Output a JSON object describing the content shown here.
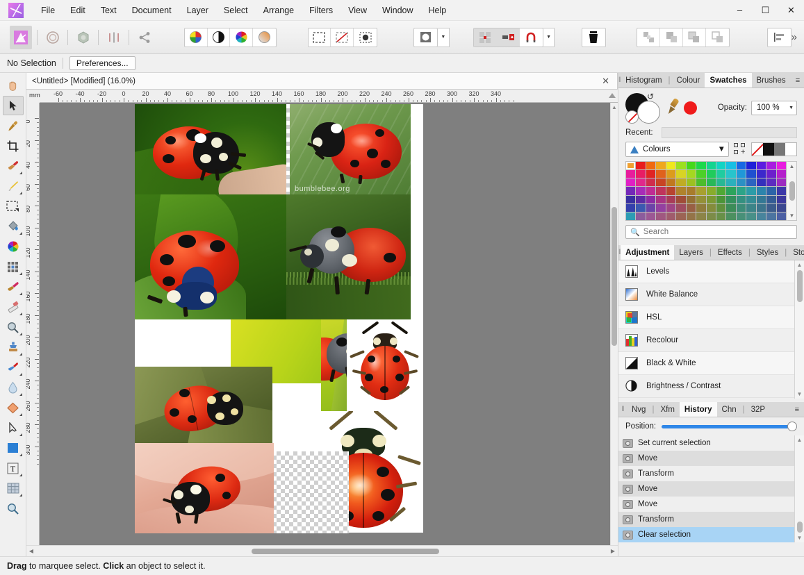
{
  "app": {
    "logo": "affinity-logo",
    "menu": [
      "File",
      "Edit",
      "Text",
      "Document",
      "Layer",
      "Select",
      "Arrange",
      "Filters",
      "View",
      "Window",
      "Help"
    ],
    "window_controls": {
      "minimize": "–",
      "maximize": "☐",
      "close": "✕"
    }
  },
  "toolbar": {
    "groups": [
      {
        "name": "personas",
        "buttons": [
          "photo-persona",
          "liquify-persona",
          "develop-persona",
          "tone-mapping-persona",
          "export-persona"
        ]
      },
      {
        "name": "adjustments",
        "buttons": [
          "colour-wheel-icon",
          "contrast-icon",
          "hsl-icon",
          "gradient-icon"
        ]
      },
      {
        "name": "selection",
        "buttons": [
          "marquee-icon",
          "deselect-icon",
          "refine-selection-icon"
        ]
      },
      {
        "name": "shape",
        "buttons": [
          "shape-icon"
        ]
      },
      {
        "name": "snapping",
        "buttons": [
          "grid-icon",
          "snap-panel-icon",
          "magnet-icon"
        ]
      },
      {
        "name": "trash",
        "buttons": [
          "trash-icon"
        ]
      },
      {
        "name": "boolean",
        "buttons": [
          "separate-icon",
          "add-icon",
          "subtract-icon",
          "intersect-icon"
        ]
      },
      {
        "name": "align",
        "buttons": [
          "align-left-icon"
        ]
      }
    ],
    "overflow": "»"
  },
  "context_bar": {
    "selection_status": "No Selection",
    "preferences_label": "Preferences..."
  },
  "document": {
    "tab_title": "<Untitled> [Modified] (16.0%)",
    "close_glyph": "✕",
    "zoom": "16.0%",
    "modified": true
  },
  "rulers": {
    "unit": "mm",
    "horizontal_ticks": [
      -60,
      -40,
      -20,
      0,
      20,
      40,
      60,
      80,
      100,
      120,
      140,
      160,
      180,
      200,
      220,
      240,
      260,
      280,
      300,
      320,
      340
    ],
    "vertical_ticks": [
      0,
      20,
      40,
      60,
      80,
      100,
      120,
      140,
      160,
      180,
      200,
      220,
      240,
      260,
      280,
      300
    ]
  },
  "tools": {
    "selected": "move-tool",
    "items": [
      {
        "name": "view-tool",
        "glyph": "✋"
      },
      {
        "name": "move-tool",
        "glyph": "➤"
      },
      {
        "name": "colour-picker-tool",
        "glyph": "✒"
      },
      {
        "name": "crop-tool",
        "glyph": "⌗"
      },
      {
        "name": "paint-brush-tool",
        "glyph": "✎"
      },
      {
        "name": "dodge-brush-tool",
        "glyph": "✒"
      },
      {
        "name": "marquee-selection-tool",
        "glyph": "⬚"
      },
      {
        "name": "flood-fill-tool",
        "glyph": "⛃"
      },
      {
        "name": "colour-replacement-tool",
        "glyph": "◕"
      },
      {
        "name": "pixel-tool",
        "glyph": "▦"
      },
      {
        "name": "paint-mixer-tool",
        "glyph": "✐"
      },
      {
        "name": "erase-brush-tool",
        "glyph": "◫"
      },
      {
        "name": "zoom-in-tool",
        "glyph": "⚲"
      },
      {
        "name": "clone-brush-tool",
        "glyph": "⚙"
      },
      {
        "name": "smudge-brush-tool",
        "glyph": "✒"
      },
      {
        "name": "blur-brush-tool",
        "glyph": "Ὂ7"
      },
      {
        "name": "shape-tool",
        "glyph": "◆"
      },
      {
        "name": "node-tool",
        "glyph": "▷"
      },
      {
        "name": "rectangle-tool",
        "glyph": "■"
      },
      {
        "name": "artistic-text-tool",
        "glyph": "T"
      },
      {
        "name": "mesh-warp-tool",
        "glyph": "▦"
      },
      {
        "name": "zoom-tool",
        "glyph": "⚲"
      }
    ]
  },
  "canvas": {
    "background_colour": "#7f7f7f",
    "page_colour": "#ffffff",
    "photos": [
      {
        "name": "ladybird-on-finger-green-bg",
        "caption": ""
      },
      {
        "name": "ladybird-on-leaf-watermarked",
        "caption": "bumblebee.org"
      },
      {
        "name": "ladybird-blue-spots-leaf",
        "caption": ""
      },
      {
        "name": "grey-ladybird-on-stem",
        "caption": ""
      },
      {
        "name": "ladybird-yellow-green-bg",
        "caption": ""
      },
      {
        "name": "ladybird-side-on-grass",
        "caption": ""
      },
      {
        "name": "ladybird-illustration-top",
        "caption": ""
      },
      {
        "name": "ladybird-on-leaf-olive",
        "caption": ""
      },
      {
        "name": "ladybird-on-human-skin",
        "caption": ""
      },
      {
        "name": "ladybird-illustration-large",
        "caption": ""
      },
      {
        "name": "transparency-checker-region",
        "caption": ""
      }
    ]
  },
  "colour_panel": {
    "tabs": [
      {
        "label": "Histogram",
        "active": false
      },
      {
        "label": "|",
        "divider": true
      },
      {
        "label": "Colour",
        "active": false
      },
      {
        "label": "Swatches",
        "active": true
      },
      {
        "label": "Brushes",
        "active": false
      }
    ],
    "menu_glyph": "≡",
    "opacity_label": "Opacity:",
    "opacity_value": "100 %",
    "recent_label": "Recent:",
    "palette_name": "Colours",
    "search_placeholder": "Search",
    "fill_colour": "#000000",
    "stroke_colour": "#ffffff",
    "accent_colour": "#ef1b1b",
    "swatch_rows": [
      [
        "#f0a030",
        "#e81c1c",
        "#f06a10",
        "#f0a81c",
        "#f0e81c",
        "#9ce020",
        "#44d81c",
        "#1cd84c",
        "#14d490",
        "#12d4c4",
        "#18c0e4",
        "#1868e4",
        "#2020d8",
        "#5c1ce0",
        "#a81ce0",
        "#e81ce0"
      ],
      [
        "#e81c9c",
        "#e81c64",
        "#e02424",
        "#e0621c",
        "#dc9c1c",
        "#d8d424",
        "#a4d820",
        "#4cd028",
        "#20cc5c",
        "#20cca0",
        "#28c4cc",
        "#2098d8",
        "#2050d0",
        "#3c28cc",
        "#6c20cc",
        "#b420cc"
      ],
      [
        "#e020c4",
        "#e0288c",
        "#d02c4c",
        "#c84424",
        "#c07820",
        "#c0ac24",
        "#9cc020",
        "#4cbc2c",
        "#28b858",
        "#28b894",
        "#2cb0bc",
        "#2c90c4",
        "#2c64c0",
        "#3430bc",
        "#5c2cc0",
        "#9c2cc0"
      ],
      [
        "#7428b8",
        "#a82cb8",
        "#c02c94",
        "#c0345c",
        "#b84430",
        "00",
        "#a87c2c",
        "#a8a030",
        "#88ac2c",
        "#50a834",
        "#2ca45c",
        "#2ca488",
        "#2c9ca8",
        "#2c84ac",
        "#2c64a8",
        "#3c38a8"
      ],
      [
        "#3830a0",
        "#5c2ca4",
        "#8c2ca4",
        "#a83484",
        "#a83c58",
        "#a04c38",
        "#947034",
        "#949038",
        "#7c9834",
        "#4c9438",
        "#34905c",
        "#349080",
        "#348c94",
        "#347894",
        "#345c94",
        "#3c389c"
      ],
      [
        "#3440ac",
        "#3c58b0",
        "#6c44a8",
        "#9440a0",
        "#a04484",
        "#a04c60",
        "#986044",
        "#907c3c",
        "#848c3c",
        "#60903c",
        "#3c8c58",
        "#3c8c78",
        "#3c8488",
        "#3c748c",
        "#3c5c8c",
        "#3c4890"
      ],
      [
        "#2c9cb4",
        "#8c5c9c",
        "#9c5894",
        "#a05880",
        "#a05c6c",
        "#9c6454",
        "#947448",
        "#8c8448",
        "#7c8c48",
        "#689048",
        "#4c9060",
        "#489078",
        "#489088",
        "#48849c",
        "#4c74a0",
        "#4c60a4"
      ]
    ]
  },
  "adjustment_panel": {
    "tabs": [
      {
        "label": "Adjustment",
        "active": true
      },
      {
        "label": "Layers",
        "active": false
      },
      {
        "label": "Effects",
        "active": false
      },
      {
        "label": "Styles",
        "active": false
      },
      {
        "label": "Stock",
        "active": false
      }
    ],
    "items": [
      {
        "label": "Levels",
        "icon": "levels-icon"
      },
      {
        "label": "White Balance",
        "icon": "white-balance-icon"
      },
      {
        "label": "HSL",
        "icon": "hsl-icon"
      },
      {
        "label": "Recolour",
        "icon": "recolour-icon"
      },
      {
        "label": "Black & White",
        "icon": "black-and-white-icon"
      },
      {
        "label": "Brightness / Contrast",
        "icon": "brightness-contrast-icon"
      }
    ]
  },
  "history_panel": {
    "tabs": [
      {
        "label": "Nvg",
        "active": false
      },
      {
        "label": "|",
        "divider": true
      },
      {
        "label": "Xfm",
        "active": false
      },
      {
        "label": "History",
        "active": true
      },
      {
        "label": "Chn",
        "active": false
      },
      {
        "label": "|",
        "divider": true
      },
      {
        "label": "32P",
        "active": false
      }
    ],
    "menu_glyph": "≡",
    "position_label": "Position:",
    "position_value": 100,
    "slider_colour": "#2f87e8",
    "entries": [
      {
        "label": "Set current selection",
        "selected": false
      },
      {
        "label": "Move",
        "selected": false
      },
      {
        "label": "Transform",
        "selected": false
      },
      {
        "label": "Move",
        "selected": false
      },
      {
        "label": "Move",
        "selected": false
      },
      {
        "label": "Transform",
        "selected": false
      },
      {
        "label": "Clear selection",
        "selected": true
      }
    ]
  },
  "status_bar": {
    "hint_bold_1": "Drag",
    "hint_text_1": " to marquee select. ",
    "hint_bold_2": "Click",
    "hint_text_2": " an object to select it."
  }
}
